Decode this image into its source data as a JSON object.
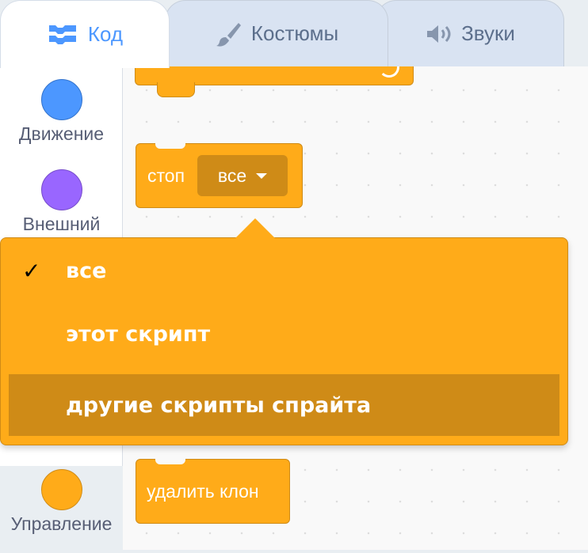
{
  "tabs": {
    "code": "Код",
    "costumes": "Костюмы",
    "sounds": "Звуки"
  },
  "categories": [
    {
      "label": "Движение",
      "color": "#4c97ff"
    },
    {
      "label": "Внешний",
      "color": "#9966ff"
    },
    {
      "label": "Управление",
      "color": "#ffab19"
    }
  ],
  "blocks": {
    "stop_label": "стоп",
    "stop_option": "все",
    "delete_clone_label": "удалить клон"
  },
  "dropdown_menu": {
    "items": [
      {
        "label": "все",
        "selected": true
      },
      {
        "label": "этот скрипт",
        "selected": false
      },
      {
        "label": "другие скрипты спрайта",
        "selected": false,
        "highlighted": true
      }
    ],
    "check_mark": "✓"
  },
  "colors": {
    "control": "#ffab19",
    "control_dark": "#cf8b17",
    "accent": "#4c97ff"
  }
}
